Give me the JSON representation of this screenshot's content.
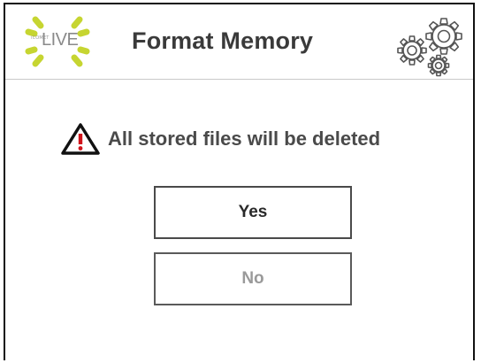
{
  "header": {
    "logo_small_text": "iCOMET",
    "logo_text": "LIVE",
    "title": "Format Memory",
    "logo_accent_color": "#c6d531",
    "settings_icon": "gears-icon"
  },
  "dialog": {
    "warning_icon": "warning-triangle-icon",
    "warning_text": "All stored files will be deleted",
    "warning_accent_color": "#d0141b",
    "yes_label": "Yes",
    "no_label": "No"
  }
}
